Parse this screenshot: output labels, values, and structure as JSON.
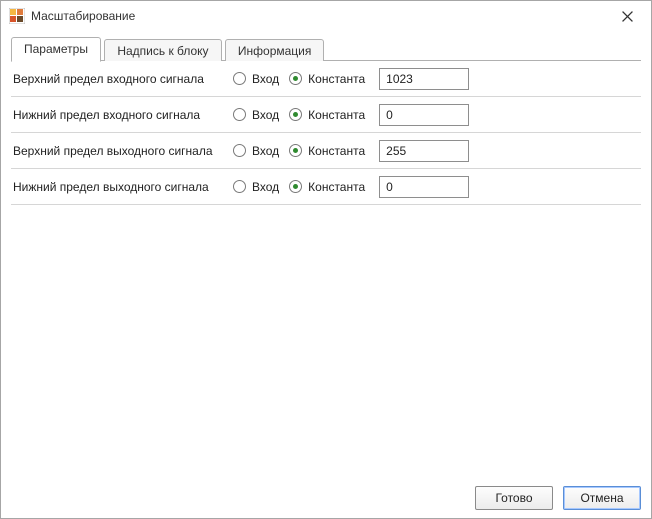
{
  "window": {
    "title": "Масштабирование"
  },
  "tabs": [
    {
      "label": "Параметры",
      "active": true
    },
    {
      "label": "Надпись к блоку",
      "active": false
    },
    {
      "label": "Информация",
      "active": false
    }
  ],
  "radio_labels": {
    "input": "Вход",
    "constant": "Константа"
  },
  "rows": [
    {
      "label": "Верхний предел входного сигнала",
      "selected": "constant",
      "value": "1023"
    },
    {
      "label": "Нижний предел входного сигнала",
      "selected": "constant",
      "value": "0"
    },
    {
      "label": "Верхний предел выходного сигнала",
      "selected": "constant",
      "value": "255"
    },
    {
      "label": "Нижний предел выходного сигнала",
      "selected": "constant",
      "value": "0"
    }
  ],
  "buttons": {
    "ok": "Готово",
    "cancel": "Отмена"
  }
}
